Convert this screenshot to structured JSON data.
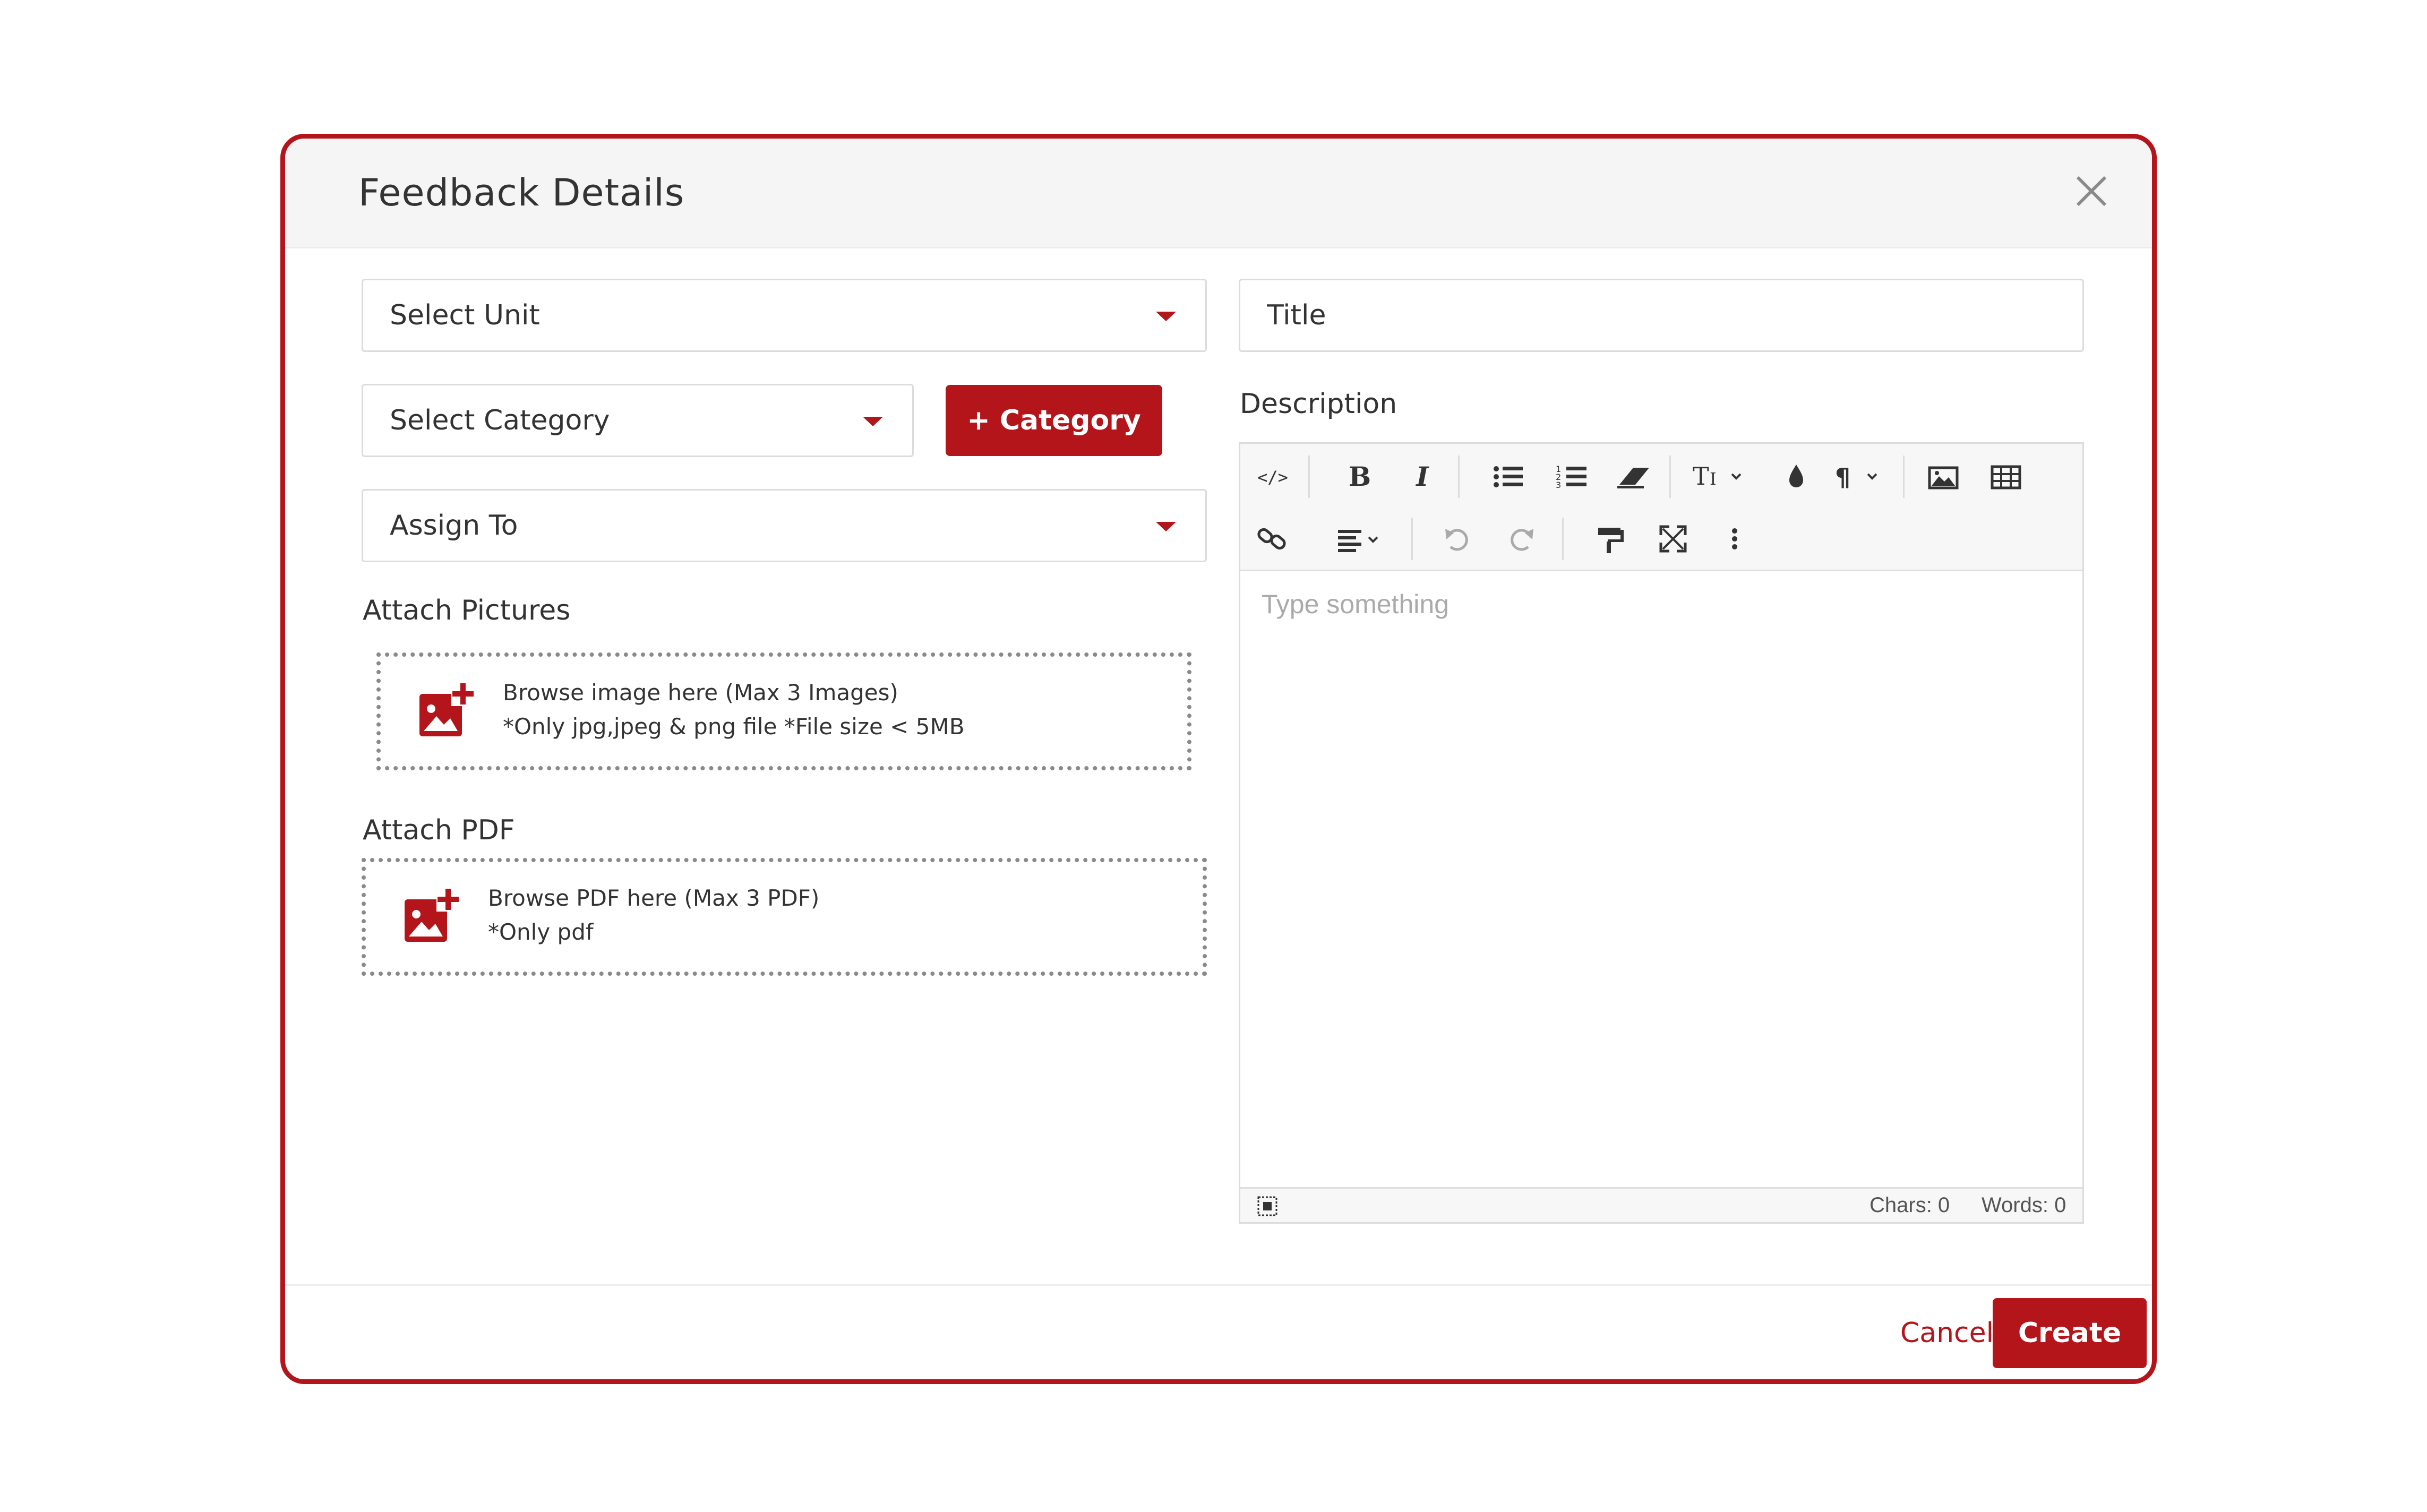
{
  "modal": {
    "title": "Feedback Details"
  },
  "form": {
    "unit_select": "Select Unit",
    "category_select": "Select Category",
    "add_category_button": "+ Category",
    "assign_select": "Assign To",
    "title_placeholder": "Title",
    "description_label": "Description",
    "attach_pictures": {
      "label": "Attach Pictures",
      "line1": "Browse image here (Max 3 Images)",
      "line2": "*Only jpg,jpeg & png file *File size < 5MB"
    },
    "attach_pdf": {
      "label": "Attach PDF",
      "line1": "Browse PDF here (Max 3 PDF)",
      "line2": "*Only pdf"
    }
  },
  "editor": {
    "placeholder": "Type something",
    "chars": "Chars: 0",
    "words": "Words: 0",
    "toolbar_icons": [
      "code-view-icon",
      "bold-icon",
      "italic-icon",
      "bullet-list-icon",
      "numbered-list-icon",
      "eraser-icon",
      "font-size-icon",
      "text-color-icon",
      "paragraph-icon",
      "image-icon",
      "table-icon",
      "link-icon",
      "align-icon",
      "undo-icon",
      "redo-icon",
      "format-painter-icon",
      "fullscreen-icon",
      "more-icon"
    ]
  },
  "footer": {
    "cancel": "Cancel",
    "create": "Create"
  },
  "colors": {
    "accent": "#b3151a",
    "header_bg": "#f5f5f5"
  }
}
